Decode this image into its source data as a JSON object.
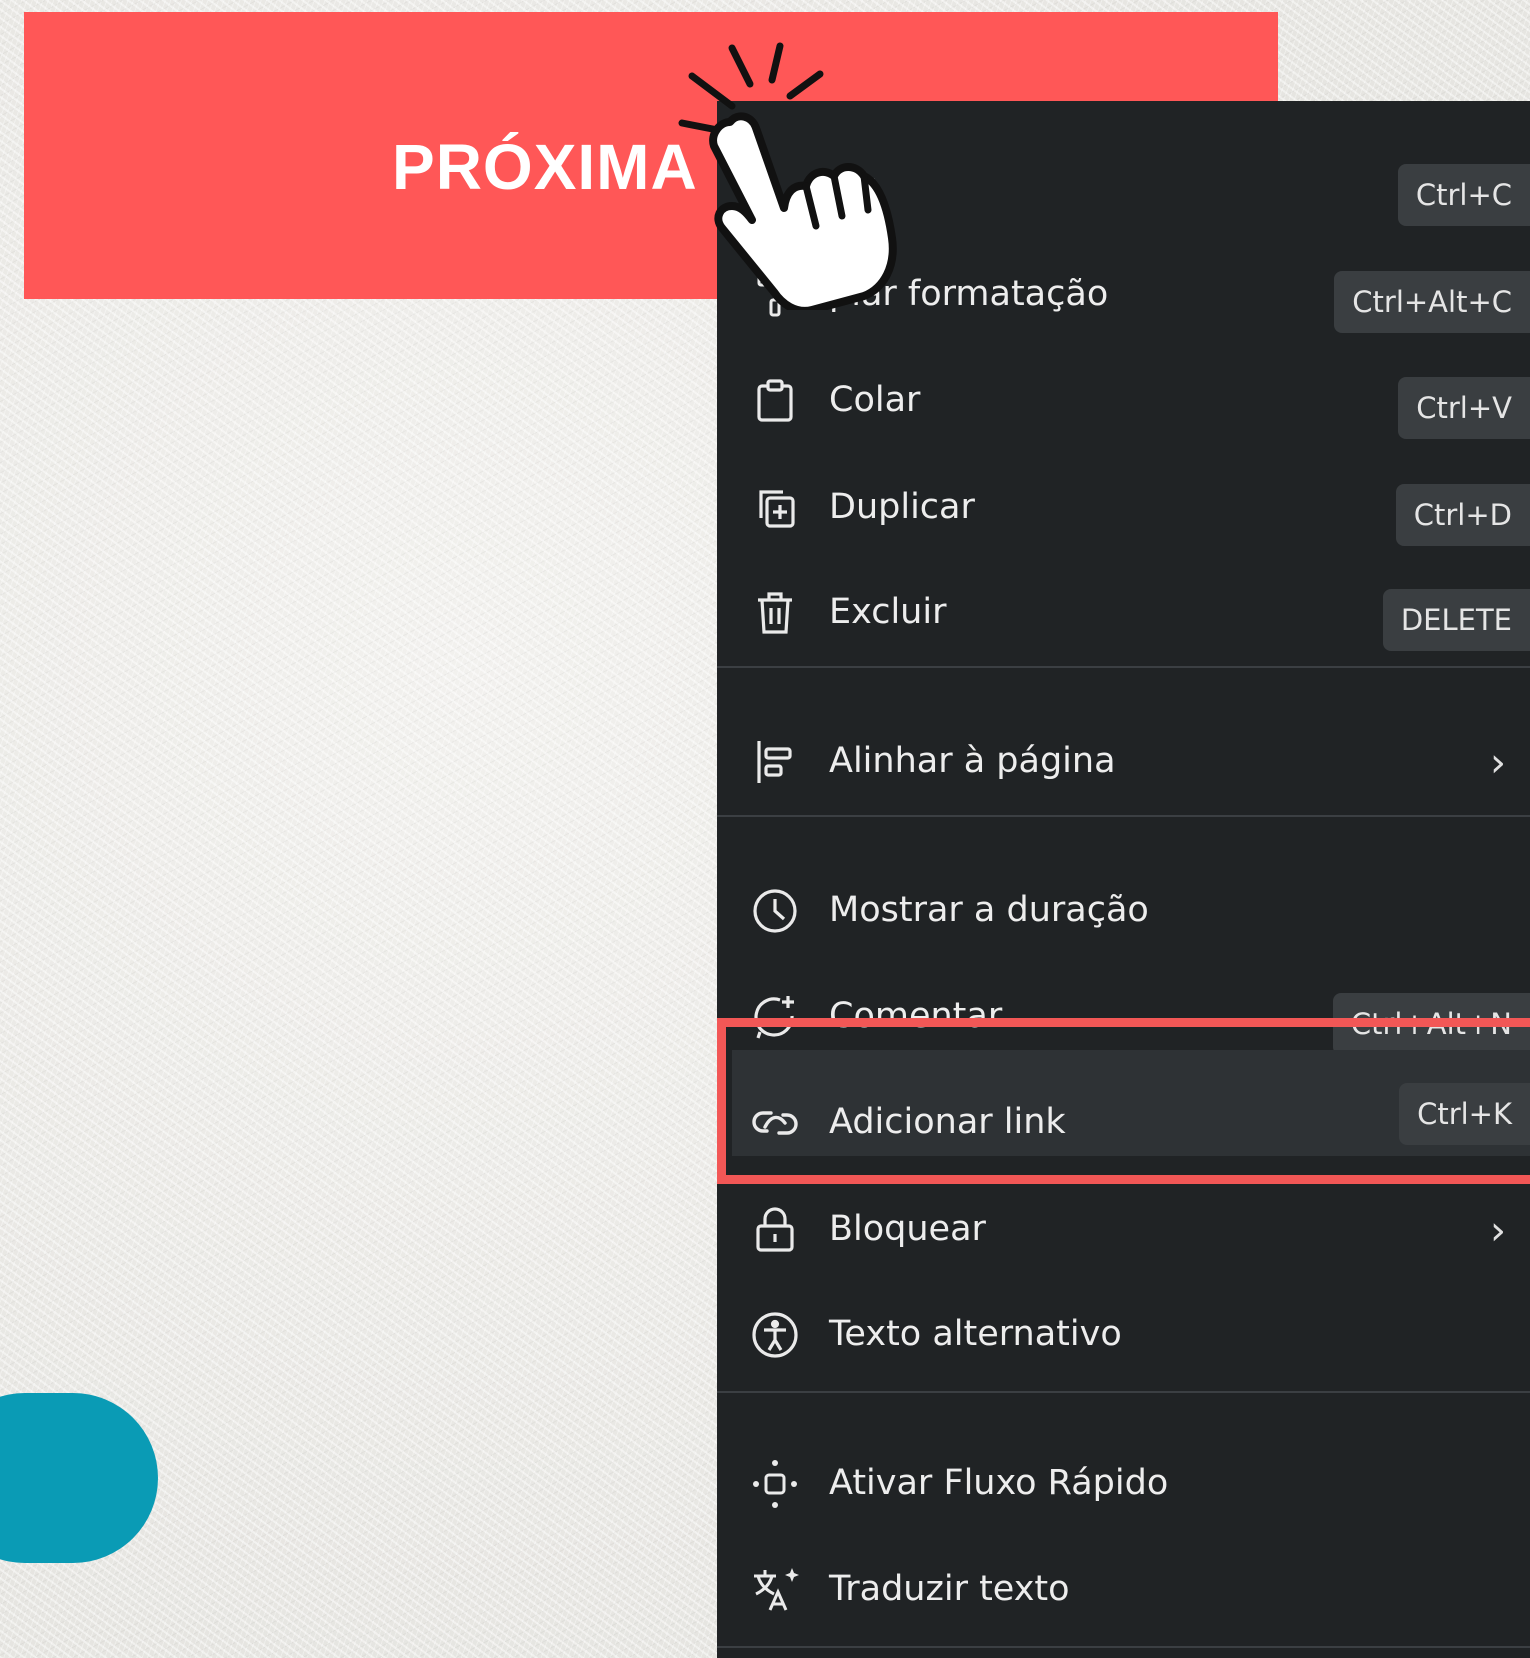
{
  "banner": {
    "text": "PRÓXIMA P"
  },
  "menu": {
    "items": [
      {
        "label": "iar",
        "shortcut": "Ctrl+C",
        "icon": "copy-icon"
      },
      {
        "label": "piar formatação",
        "shortcut": "Ctrl+Alt+C",
        "icon": "paint-roller-icon"
      },
      {
        "label": "Colar",
        "shortcut": "Ctrl+V",
        "icon": "clipboard-icon"
      },
      {
        "label": "Duplicar",
        "shortcut": "Ctrl+D",
        "icon": "duplicate-icon"
      },
      {
        "label": "Excluir",
        "shortcut": "DELETE",
        "icon": "trash-icon"
      },
      {
        "label": "Alinhar à página",
        "chevron": "›",
        "icon": "align-left-icon"
      },
      {
        "label": "Mostrar a duração",
        "icon": "clock-icon"
      },
      {
        "label": "Comentar",
        "shortcut": "Ctrl+Alt+N",
        "icon": "comment-add-icon"
      },
      {
        "label": "Adicionar link",
        "shortcut": "Ctrl+K",
        "icon": "link-icon",
        "highlighted": true
      },
      {
        "label": "Bloquear",
        "chevron": "›",
        "icon": "lock-icon"
      },
      {
        "label": "Texto alternativo",
        "icon": "accessibility-icon"
      },
      {
        "label": "Ativar Fluxo Rápido",
        "icon": "quick-flow-icon"
      },
      {
        "label": "Traduzir texto",
        "icon": "translate-icon"
      }
    ]
  },
  "colors": {
    "banner": "#ff5757",
    "menu_bg": "#202325",
    "highlight_border": "#f25756",
    "accent_pill": "#0a9bb5"
  }
}
